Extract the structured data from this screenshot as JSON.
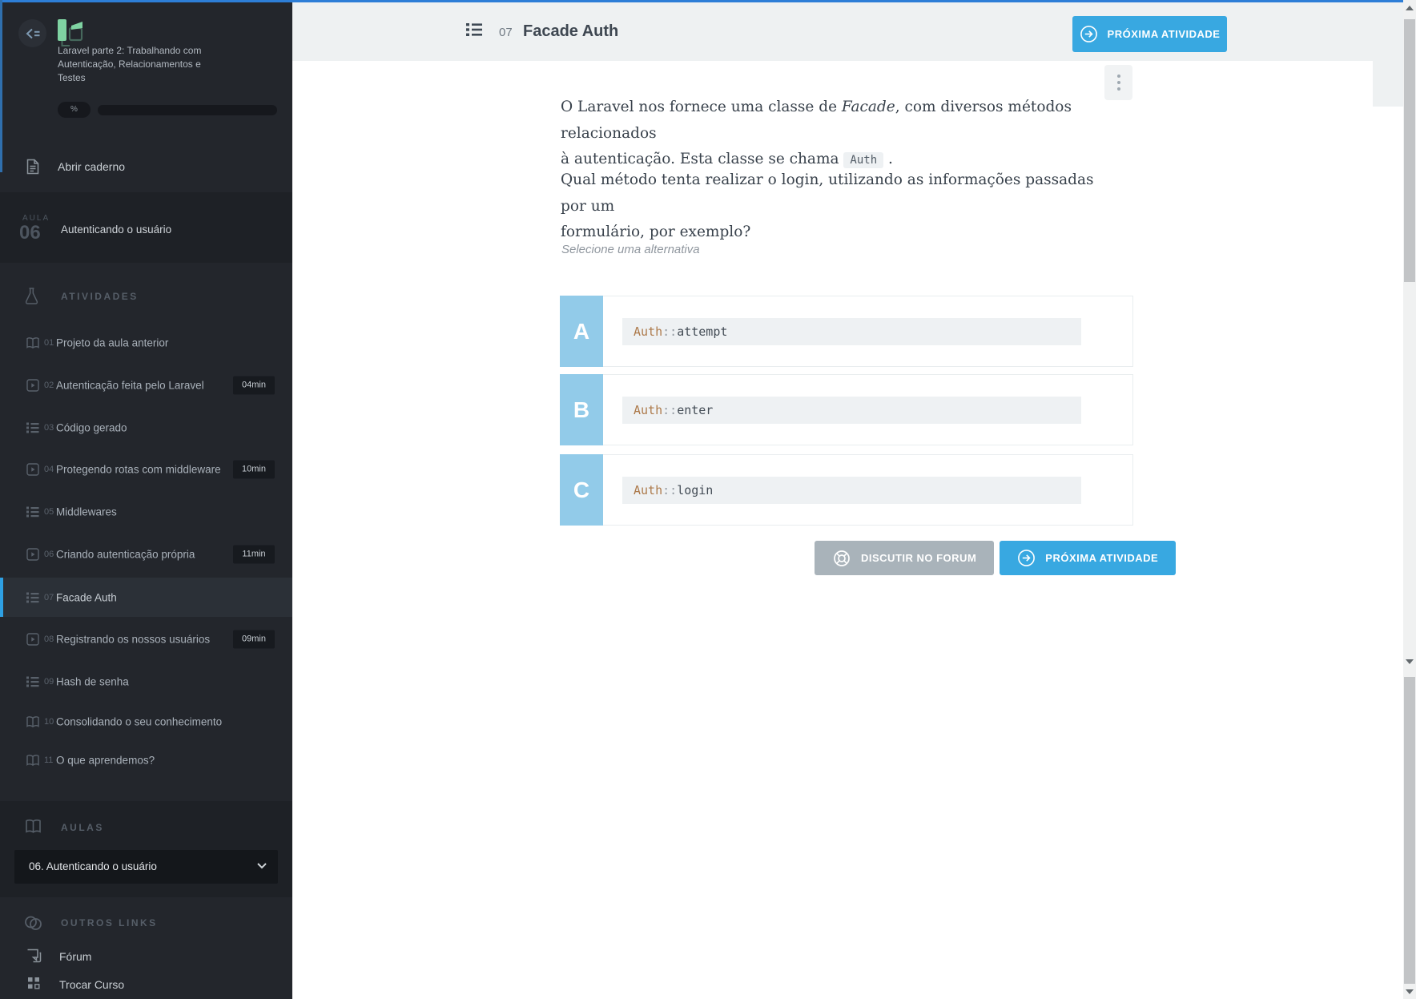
{
  "colors": {
    "topline_blue": "#2d7ed7",
    "accent_blue": "#38a8e1",
    "option_letter_blue": "#92cbe9",
    "selected_item_bar": "#2ea0e4",
    "sidebar_bg": "#23262c",
    "sidebar_section_bg": "#1e2126",
    "header_bg": "#eef1f2",
    "code_class_color": "#ad7a4b"
  },
  "sidebar": {
    "course_title": "Laravel parte 2: Trabalhando com Autenticação, Relacionamentos e Testes",
    "progress_label": "%",
    "open_notebook_label": "Abrir caderno",
    "lesson_banner": {
      "kicker": "AULA",
      "number": "06",
      "title": "Autenticando o usuário"
    },
    "activities_header": "ATIVIDADES",
    "activities": [
      {
        "number": "01",
        "label": "Projeto da aula anterior",
        "icon": "book-icon"
      },
      {
        "number": "02",
        "label": "Autenticação feita pelo Laravel",
        "icon": "video-icon",
        "duration": "04min"
      },
      {
        "number": "03",
        "label": "Código gerado",
        "icon": "list-icon"
      },
      {
        "number": "04",
        "label": "Protegendo rotas com middleware",
        "icon": "video-icon",
        "duration": "10min"
      },
      {
        "number": "05",
        "label": "Middlewares",
        "icon": "list-icon"
      },
      {
        "number": "06",
        "label": "Criando autenticação própria",
        "icon": "video-icon",
        "duration": "11min"
      },
      {
        "number": "07",
        "label": "Facade Auth",
        "icon": "list-icon",
        "selected": true
      },
      {
        "number": "08",
        "label": "Registrando os nossos usuários",
        "icon": "video-icon",
        "duration": "09min"
      },
      {
        "number": "09",
        "label": "Hash de senha",
        "icon": "list-icon"
      },
      {
        "number": "10",
        "label": "Consolidando o seu conhecimento",
        "icon": "book-icon"
      },
      {
        "number": "11",
        "label": "O que aprendemos?",
        "icon": "book-icon"
      }
    ],
    "aulas_header": "AULAS",
    "lesson_select_value": "06. Autenticando o usuário",
    "other_links_header": "OUTROS LINKS",
    "forum_label": "Fórum",
    "switch_course_label": "Trocar Curso"
  },
  "header": {
    "activity_number": "07",
    "title": "Facade Auth",
    "next_button_label": "PRÓXIMA ATIVIDADE"
  },
  "question": {
    "p1_pre": "O Laravel nos fornece uma classe de ",
    "p1_italic": "Facade",
    "p1_rest_line1": ", com diversos métodos relacionados",
    "p1_line2": "à autenticação. Esta classe se chama ",
    "p1_code": "Auth",
    "p1_after_code": " .",
    "p2_line1": "Qual método tenta realizar o login, utilizando as informações passadas por um",
    "p2_line2": "formulário, por exemplo?",
    "select_prompt": "Selecione uma alternativa",
    "options": [
      {
        "letter": "A",
        "code_class": "Auth",
        "code_sep": "::",
        "code_method": "attempt"
      },
      {
        "letter": "B",
        "code_class": "Auth",
        "code_sep": "::",
        "code_method": "enter"
      },
      {
        "letter": "C",
        "code_class": "Auth",
        "code_sep": "::",
        "code_method": "login"
      }
    ]
  },
  "footer": {
    "discuss_button_label": "DISCUTIR NO FORUM",
    "next_button_label": "PRÓXIMA ATIVIDADE"
  }
}
